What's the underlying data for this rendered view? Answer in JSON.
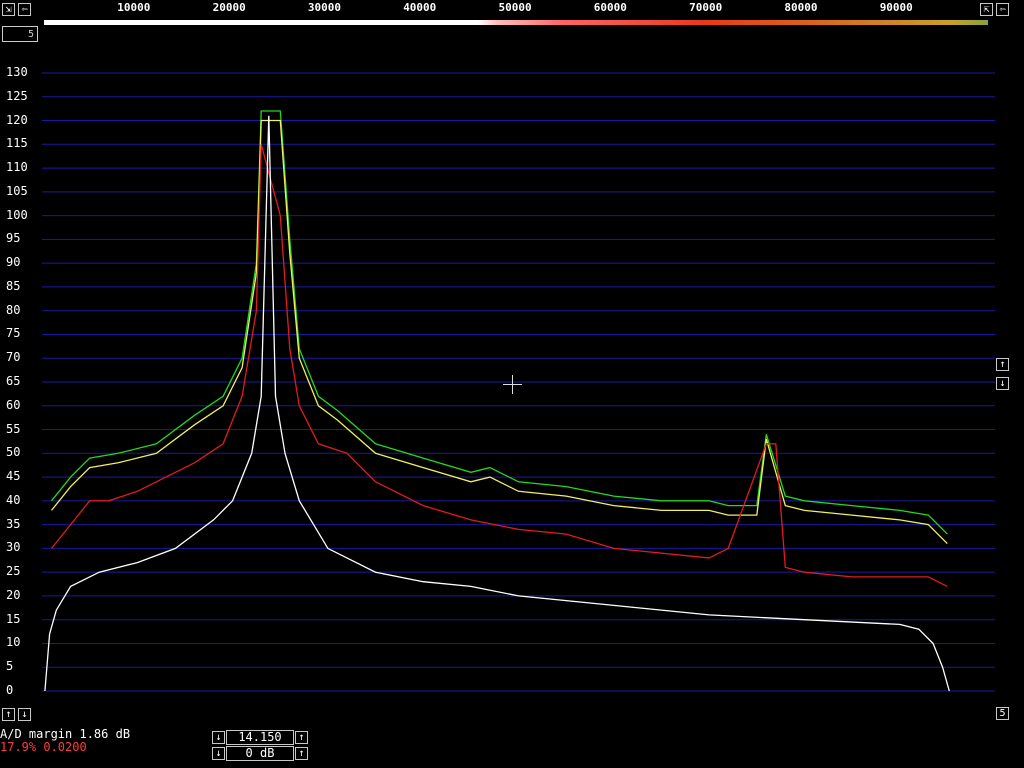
{
  "toolbar": {
    "x_ticks": [
      "10000",
      "20000",
      "30000",
      "40000",
      "50000",
      "60000",
      "70000",
      "80000",
      "90000"
    ],
    "left_arrows": [
      "⇲",
      "⇦"
    ],
    "right_arrows": [
      "⇱",
      "⇦"
    ]
  },
  "corner_box": "5",
  "y_ticks": [
    "130",
    "125",
    "120",
    "115",
    "110",
    "105",
    "100",
    "95",
    "90",
    "85",
    "80",
    "75",
    "70",
    "65",
    "60",
    "55",
    "50",
    "45",
    "40",
    "35",
    "30",
    "25",
    "20",
    "15",
    "10",
    "5",
    "0"
  ],
  "status": {
    "ad_margin": "A/D margin 1.86 dB",
    "level": "17.9% 0.0200"
  },
  "controls": {
    "gain": "14.150",
    "offset": "0 dB"
  },
  "right_buttons": {
    "up": "↑",
    "down": "↓",
    "five": "5"
  },
  "bottom_left_buttons": {
    "up": "↑",
    "down": "↓"
  },
  "colors": {
    "grid": "#1a1aa0",
    "green": "#22d822",
    "yellow": "#f0f060",
    "red": "#e01c1c",
    "white": "#ffffff"
  },
  "chart_data": {
    "type": "line",
    "xlim": [
      0,
      100000
    ],
    "ylim": [
      0,
      130
    ],
    "y_ticks": [
      0,
      5,
      10,
      15,
      20,
      25,
      30,
      35,
      40,
      45,
      50,
      55,
      60,
      65,
      70,
      75,
      80,
      85,
      90,
      95,
      100,
      105,
      110,
      115,
      120,
      125,
      130
    ],
    "x_ticks": [
      10000,
      20000,
      30000,
      40000,
      50000,
      60000,
      70000,
      80000,
      90000
    ],
    "series": [
      {
        "color": "green",
        "x": [
          1000,
          3000,
          5000,
          8000,
          12000,
          16000,
          19000,
          21000,
          22500,
          23000,
          25000,
          26000,
          27000,
          29000,
          31000,
          35000,
          40000,
          45000,
          47000,
          50000,
          55000,
          60000,
          65000,
          70000,
          72000,
          75000,
          76000,
          78000,
          80000,
          85000,
          90000,
          93000,
          95000
        ],
        "y": [
          40,
          45,
          49,
          50,
          52,
          58,
          62,
          70,
          90,
          122,
          122,
          95,
          72,
          62,
          59,
          52,
          49,
          46,
          47,
          44,
          43,
          41,
          40,
          40,
          39,
          39,
          54,
          41,
          40,
          39,
          38,
          37,
          33
        ]
      },
      {
        "color": "yellow",
        "x": [
          1000,
          3000,
          5000,
          8000,
          12000,
          16000,
          19000,
          21000,
          22500,
          23000,
          25000,
          26000,
          27000,
          29000,
          31000,
          35000,
          40000,
          45000,
          47000,
          50000,
          55000,
          60000,
          65000,
          70000,
          72000,
          75000,
          76000,
          78000,
          80000,
          85000,
          90000,
          93000,
          95000
        ],
        "y": [
          38,
          43,
          47,
          48,
          50,
          56,
          60,
          68,
          88,
          120,
          120,
          92,
          70,
          60,
          57,
          50,
          47,
          44,
          45,
          42,
          41,
          39,
          38,
          38,
          37,
          37,
          53,
          39,
          38,
          37,
          36,
          35,
          31
        ]
      },
      {
        "color": "red",
        "x": [
          1000,
          3000,
          5000,
          7000,
          10000,
          13000,
          16000,
          19000,
          21000,
          22500,
          23000,
          25000,
          26000,
          27000,
          29000,
          32000,
          35000,
          40000,
          45000,
          50000,
          55000,
          60000,
          70000,
          72000,
          76000,
          77000,
          78000,
          80000,
          85000,
          90000,
          93000,
          95000
        ],
        "y": [
          30,
          35,
          40,
          40,
          42,
          45,
          48,
          52,
          62,
          80,
          115,
          100,
          72,
          60,
          52,
          50,
          44,
          39,
          36,
          34,
          33,
          30,
          28,
          30,
          52,
          52,
          26,
          25,
          24,
          24,
          24,
          22
        ]
      },
      {
        "color": "white",
        "x": [
          300,
          800,
          1500,
          3000,
          6000,
          10000,
          14000,
          18000,
          20000,
          22000,
          23000,
          23800,
          24500,
          25500,
          27000,
          30000,
          35000,
          40000,
          45000,
          50000,
          60000,
          70000,
          80000,
          90000,
          92000,
          93500,
          94500,
          95200
        ],
        "y": [
          0,
          12,
          17,
          22,
          25,
          27,
          30,
          36,
          40,
          50,
          62,
          121,
          62,
          50,
          40,
          30,
          25,
          23,
          22,
          20,
          18,
          16,
          15,
          14,
          13,
          10,
          5,
          0
        ]
      }
    ]
  }
}
